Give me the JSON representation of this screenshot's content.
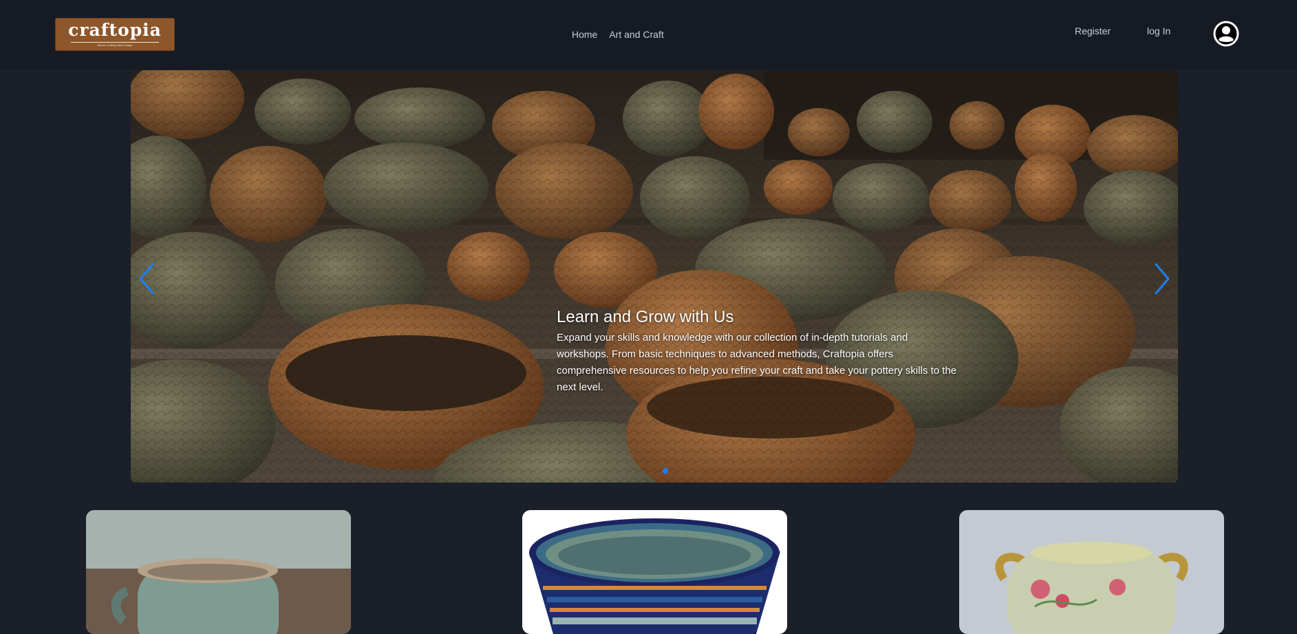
{
  "navbar": {
    "logo": {
      "name": "craftopia",
      "tagline": "Where Crafting Takes Shape"
    },
    "links": [
      {
        "label": "Home"
      },
      {
        "label": "Art and Craft"
      }
    ],
    "register_label": "Register",
    "login_label": "log In",
    "avatar_icon": "user-circle-icon"
  },
  "carousel": {
    "slide": {
      "title": "Learn and Grow with Us",
      "text": "Expand your skills and knowledge with our collection of in-depth tutorials and workshops. From basic techniques to advanced methods, Craftopia offers comprehensive resources to help you refine your craft and take your pottery skills to the next level."
    },
    "prev_icon": "chevron-left-icon",
    "next_icon": "chevron-right-icon",
    "active_index": 0
  },
  "cards": [
    {
      "image": "glazed-mug-photo"
    },
    {
      "image": "patterned-bowl-photo"
    },
    {
      "image": "floral-vase-photo"
    }
  ],
  "colors": {
    "page_background": "#1a1f29",
    "navbar_background": "#161b23",
    "logo_background": "#8d572b",
    "accent_blue": "#1d7ff2"
  }
}
